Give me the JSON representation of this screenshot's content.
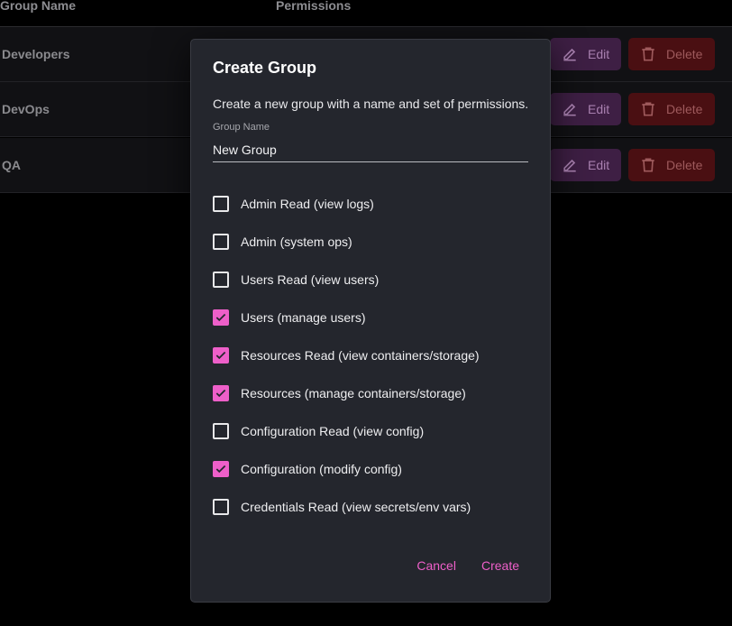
{
  "table": {
    "headers": {
      "name": "Group Name",
      "permissions": "Permissions"
    },
    "rows": [
      {
        "name": "Developers"
      },
      {
        "name": "DevOps"
      },
      {
        "name": "QA"
      }
    ],
    "edit_label": "Edit",
    "delete_label": "Delete"
  },
  "dialog": {
    "title": "Create Group",
    "description": "Create a new group with a name and set of permissions.",
    "group_name_label": "Group Name",
    "group_name_value": "New Group",
    "permissions": [
      {
        "label": "Admin Read (view logs)",
        "checked": false
      },
      {
        "label": "Admin (system ops)",
        "checked": false
      },
      {
        "label": "Users Read (view users)",
        "checked": false
      },
      {
        "label": "Users (manage users)",
        "checked": true
      },
      {
        "label": "Resources Read (view containers/storage)",
        "checked": true
      },
      {
        "label": "Resources (manage containers/storage)",
        "checked": true
      },
      {
        "label": "Configuration Read (view config)",
        "checked": false
      },
      {
        "label": "Configuration (modify config)",
        "checked": true
      },
      {
        "label": "Credentials Read (view secrets/env vars)",
        "checked": false
      }
    ],
    "cancel_label": "Cancel",
    "create_label": "Create"
  },
  "colors": {
    "accent": "#ee5fc9",
    "modal_bg": "#24262d",
    "edit_bg": "#3e1f44",
    "delete_bg": "#4a0f12"
  },
  "icons": {
    "edit": "pencil-icon",
    "delete": "trash-icon",
    "check": "checkmark-icon"
  }
}
